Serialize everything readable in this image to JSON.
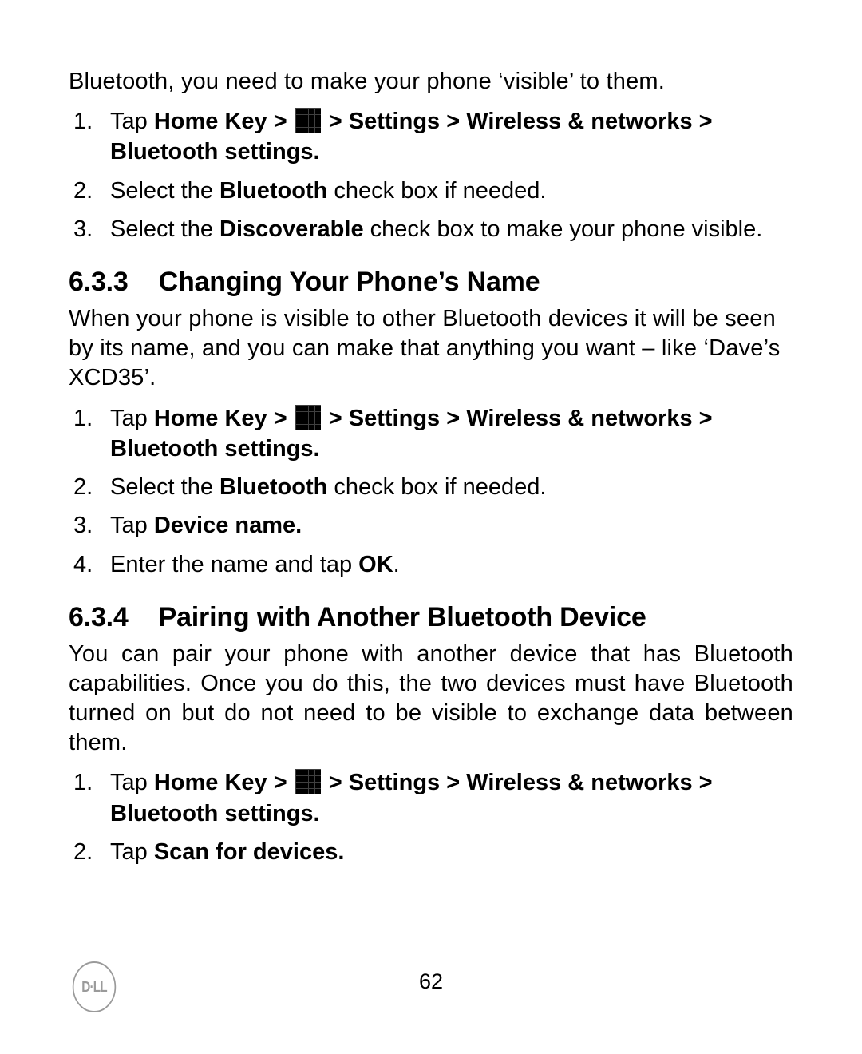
{
  "intro_line": "Bluetooth, you need to make your phone ‘visible’ to them.",
  "nav_path": {
    "pre": "Home Key >",
    "post": " > Settings > Wireless & networks > Bluetooth settings."
  },
  "steps_a": [
    {
      "num": "1.",
      "plain_prefix": "Tap "
    },
    {
      "num": "2.",
      "pre": "Select the ",
      "bold": "Bluetooth",
      "post": " check box if needed."
    },
    {
      "num": "3.",
      "pre": "Select the ",
      "bold": "Discoverable",
      "post": " check box to make your phone visible."
    }
  ],
  "section_633": {
    "num": "6.3.3",
    "title": "Changing Your Phone’s Name",
    "para": "When your phone is visible to other Bluetooth devices it will be seen by its name, and you can make that anything you want – like ‘Dave’s XCD35’."
  },
  "steps_b": [
    {
      "num": "1.",
      "plain_prefix": "Tap "
    },
    {
      "num": "2.",
      "pre": "Select the ",
      "bold": "Bluetooth",
      "post": " check box if needed."
    },
    {
      "num": "3.",
      "pre": "Tap ",
      "bold": "Device name."
    },
    {
      "num": "4.",
      "pre": "Enter the name and tap ",
      "bold": "OK",
      "post": "."
    }
  ],
  "section_634": {
    "num": "6.3.4",
    "title": "Pairing with Another Bluetooth Device",
    "para": "You can pair your phone with another device that has Bluetooth capabilities. Once you do this, the two devices must have Bluetooth turned on but do not need to be visible to exchange data between them."
  },
  "steps_c": [
    {
      "num": "1.",
      "plain_prefix": "Tap "
    },
    {
      "num": "2.",
      "pre": "Tap ",
      "bold": "Scan for devices."
    }
  ],
  "footer": {
    "page": "62",
    "logo_text": "D·LL"
  }
}
